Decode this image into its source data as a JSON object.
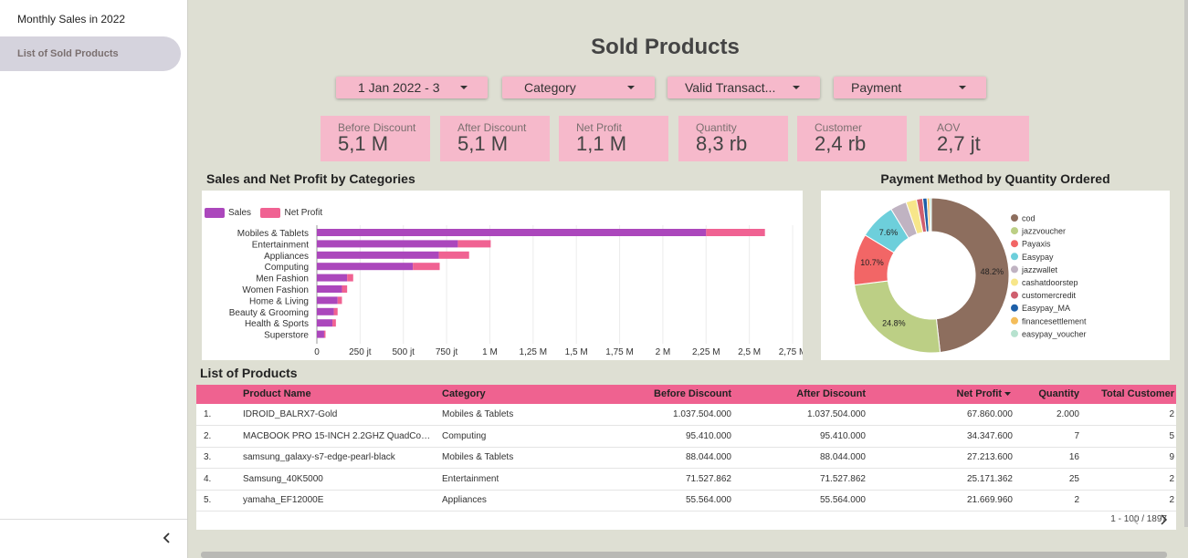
{
  "sidebar": {
    "items": [
      {
        "label": "Monthly Sales in 2022"
      },
      {
        "label": "List of Sold Products"
      }
    ],
    "collapse_icon": "chevron-left-icon"
  },
  "page": {
    "title": "Sold Products"
  },
  "filters": [
    {
      "label": "1 Jan 2022 - 3"
    },
    {
      "label": "Category"
    },
    {
      "label": "Valid Transact..."
    },
    {
      "label": "Payment"
    }
  ],
  "kpis": [
    {
      "label": "Before Discount",
      "value": "5,1 M"
    },
    {
      "label": "After Discount",
      "value": "5,1 M"
    },
    {
      "label": "Net Profit",
      "value": "1,1 M"
    },
    {
      "label": "Quantity",
      "value": "8,3 rb"
    },
    {
      "label": "Customer",
      "value": "2,4 rb"
    },
    {
      "label": "AOV",
      "value": "2,7 jt"
    }
  ],
  "chart_data": [
    {
      "type": "bar",
      "orientation": "horizontal",
      "stacked": true,
      "title": "Sales and Net Profit by Categories",
      "categories": [
        "Mobiles & Tablets",
        "Entertainment",
        "Appliances",
        "Computing",
        "Men Fashion",
        "Women Fashion",
        "Home & Living",
        "Beauty & Grooming",
        "Health & Sports",
        "Superstore"
      ],
      "series": [
        {
          "name": "Sales",
          "color": "#ab47bc",
          "values": [
            2250000,
            815000,
            705000,
            555000,
            175000,
            145000,
            120000,
            98000,
            90000,
            42000
          ]
        },
        {
          "name": "Net Profit",
          "color": "#f06292",
          "values": [
            340000,
            190000,
            175000,
            155000,
            35000,
            30000,
            25000,
            22000,
            20000,
            8000
          ]
        }
      ],
      "x_ticks": [
        "0",
        "250 jt",
        "500 jt",
        "750 jt",
        "1 M",
        "1,25 M",
        "1,5 M",
        "1,75 M",
        "2 M",
        "2,25 M",
        "2,5 M",
        "2,75 M"
      ],
      "xlim": [
        0,
        2750000
      ],
      "legend": "top-left",
      "grid": true
    },
    {
      "type": "pie",
      "donut": true,
      "title": "Payment Method by Quantity Ordered",
      "slices": [
        {
          "label": "cod",
          "value": 48.2,
          "color": "#8d6e5e"
        },
        {
          "label": "jazzvoucher",
          "value": 24.8,
          "color": "#bccf85"
        },
        {
          "label": "Payaxis",
          "value": 10.7,
          "color": "#f26666"
        },
        {
          "label": "Easypay",
          "value": 7.6,
          "color": "#6dcfdb"
        },
        {
          "label": "jazzwallet",
          "value": 3.4,
          "color": "#c0b3c2"
        },
        {
          "label": "cashatdoorstep",
          "value": 2.2,
          "color": "#f7e68a"
        },
        {
          "label": "customercredit",
          "value": 1.3,
          "color": "#cf5f6e"
        },
        {
          "label": "Easypay_MA",
          "value": 0.9,
          "color": "#1e5fa8"
        },
        {
          "label": "financesettlement",
          "value": 0.5,
          "color": "#f4bd5a"
        },
        {
          "label": "easypay_voucher",
          "value": 0.4,
          "color": "#b7e2cf"
        }
      ],
      "slice_labels": [
        "48.2%",
        "24.8%",
        "10.7%",
        "7.6%"
      ],
      "legend": "right"
    }
  ],
  "table": {
    "title": "List of Products",
    "columns": [
      "Product Name",
      "Category",
      "Before Discount",
      "After Discount",
      "Net Profit",
      "Quantity",
      "Total Customer"
    ],
    "sort_icon": "sort-desc-icon",
    "rows": [
      {
        "no": "1.",
        "name": "IDROID_BALRX7-Gold",
        "category": "Mobiles & Tablets",
        "before": "1.037.504.000",
        "after": "1.037.504.000",
        "profit": "67.860.000",
        "qty": "2.000",
        "cust": "2"
      },
      {
        "no": "2.",
        "name": "MACBOOK PRO 15-INCH 2.2GHZ QuadCore...",
        "category": "Computing",
        "before": "95.410.000",
        "after": "95.410.000",
        "profit": "34.347.600",
        "qty": "7",
        "cust": "5"
      },
      {
        "no": "3.",
        "name": "samsung_galaxy-s7-edge-pearl-black",
        "category": "Mobiles & Tablets",
        "before": "88.044.000",
        "after": "88.044.000",
        "profit": "27.213.600",
        "qty": "16",
        "cust": "9"
      },
      {
        "no": "4.",
        "name": "Samsung_40K5000",
        "category": "Entertainment",
        "before": "71.527.862",
        "after": "71.527.862",
        "profit": "25.171.362",
        "qty": "25",
        "cust": "2"
      },
      {
        "no": "5.",
        "name": "yamaha_EF12000E",
        "category": "Appliances",
        "before": "55.564.000",
        "after": "55.564.000",
        "profit": "21.669.960",
        "qty": "2",
        "cust": "2"
      }
    ],
    "pager": "1 - 100 / 1897"
  }
}
